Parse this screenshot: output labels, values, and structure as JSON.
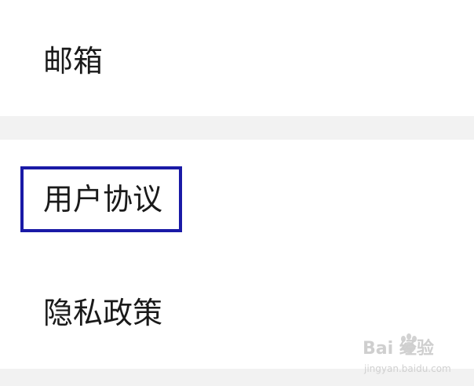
{
  "settings_list": {
    "items": [
      {
        "label": "邮箱"
      },
      {
        "label": "用户协议"
      },
      {
        "label": "隐私政策"
      }
    ]
  },
  "watermark": {
    "brand": "Bai 经验",
    "url": "jingyan.baidu.com"
  },
  "colors": {
    "background": "#ffffff",
    "section_gap": "#f2f2f2",
    "text": "#1a1a1a",
    "highlight_border": "#1a1aa6"
  }
}
